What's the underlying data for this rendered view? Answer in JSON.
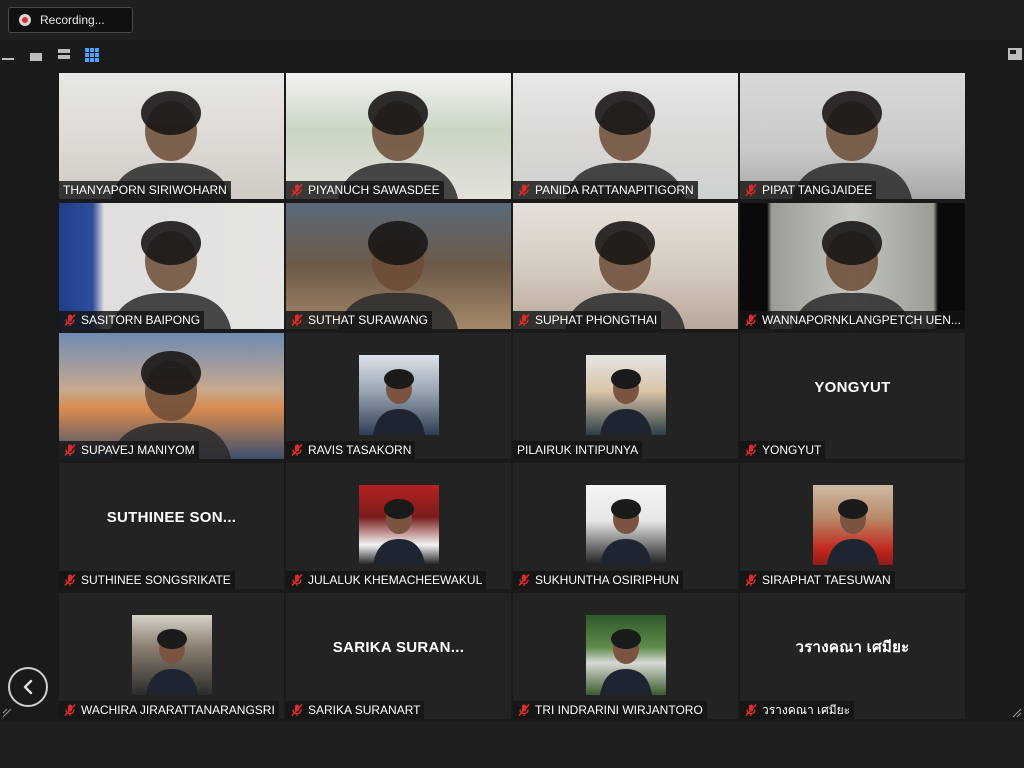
{
  "recording": {
    "label": "Recording..."
  },
  "view_icons": [
    "minimize-icon",
    "speaker-view-icon",
    "filmstrip-view-icon",
    "gallery-view-icon",
    "exit-fullscreen-icon"
  ],
  "colors": {
    "accent": "#4aa3ff",
    "muted": "#e02b2b",
    "background": "#1a1a1a"
  },
  "participants": [
    {
      "name": "THANYAPORN SIRIWOHARN",
      "muted": false,
      "kind": "video"
    },
    {
      "name": "PIYANUCH SAWASDEE",
      "muted": true,
      "kind": "video"
    },
    {
      "name": "PANIDA RATTANAPITIGORN",
      "muted": true,
      "kind": "video"
    },
    {
      "name": "PIPAT TANGJAIDEE",
      "muted": true,
      "kind": "video"
    },
    {
      "name": "SASITORN BAIPONG",
      "muted": true,
      "kind": "video"
    },
    {
      "name": "SUTHAT SURAWANG",
      "muted": true,
      "kind": "video"
    },
    {
      "name": "SUPHAT PHONGTHAI",
      "muted": true,
      "kind": "video"
    },
    {
      "name": "WANNAPORNKLANGPETCH UEN...",
      "muted": true,
      "kind": "video"
    },
    {
      "name": "SUPAVEJ MANIYOM",
      "muted": true,
      "kind": "video"
    },
    {
      "name": "RAVIS TASAKORN",
      "muted": true,
      "kind": "photo"
    },
    {
      "name": "PILAIRUK INTIPUNYA",
      "muted": false,
      "kind": "photo"
    },
    {
      "name": "YONGYUT",
      "muted": true,
      "kind": "text",
      "display": "YONGYUT"
    },
    {
      "name": "SUTHINEE SONGSRIKATE",
      "muted": true,
      "kind": "text",
      "display": "SUTHINEE  SON..."
    },
    {
      "name": "JULALUK KHEMACHEEWAKUL",
      "muted": true,
      "kind": "photo"
    },
    {
      "name": "SUKHUNTHA OSIRIPHUN",
      "muted": true,
      "kind": "photo"
    },
    {
      "name": "SIRAPHAT TAESUWAN",
      "muted": true,
      "kind": "photo"
    },
    {
      "name": "WACHIRA JIRARATTANARANGSRI",
      "muted": true,
      "kind": "photo"
    },
    {
      "name": "SARIKA  SURANART",
      "muted": true,
      "kind": "text",
      "display": "SARIKA  SURAN..."
    },
    {
      "name": "TRI INDRARINI WIRJANTORO",
      "muted": true,
      "kind": "photo"
    },
    {
      "name": "วรางคณา เศมียะ",
      "muted": true,
      "kind": "text",
      "display": "วรางคณา เศมียะ"
    }
  ]
}
